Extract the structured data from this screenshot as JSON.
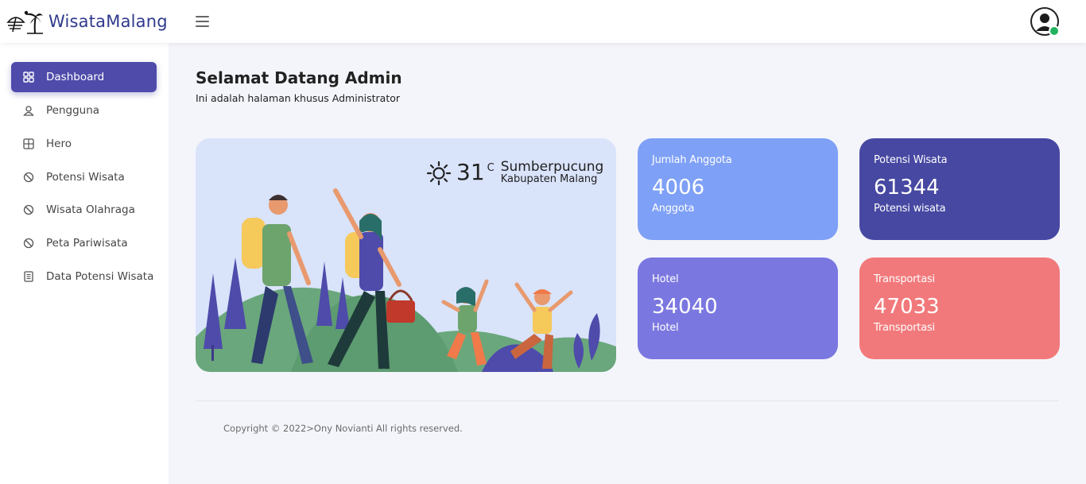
{
  "brand": {
    "name": "WisataMalang"
  },
  "sidebar": {
    "items": [
      {
        "label": "Dashboard",
        "icon": "grid-icon",
        "active": true
      },
      {
        "label": "Pengguna",
        "icon": "user-icon",
        "active": false
      },
      {
        "label": "Hero",
        "icon": "table-icon",
        "active": false
      },
      {
        "label": "Potensi Wisata",
        "icon": "ban-icon",
        "active": false
      },
      {
        "label": "Wisata Olahraga",
        "icon": "ban-icon",
        "active": false
      },
      {
        "label": "Peta Pariwisata",
        "icon": "ban-icon",
        "active": false
      },
      {
        "label": "Data Potensi Wisata",
        "icon": "document-icon",
        "active": false
      }
    ]
  },
  "main": {
    "title": "Selamat Datang Admin",
    "subtitle": "Ini adalah halaman khusus Administrator",
    "weather": {
      "icon": "sun-icon",
      "temp": "31",
      "unit": "C",
      "city": "Sumberpucung",
      "region": "Kabupaten Malang"
    },
    "stats": [
      {
        "label": "Jumlah Anggota",
        "value": "4006",
        "unit": "Anggota",
        "color": "#7ea0f6"
      },
      {
        "label": "Potensi Wisata",
        "value": "61344",
        "unit": "Potensi wisata",
        "color": "#4748a2"
      },
      {
        "label": "Hotel",
        "value": "34040",
        "unit": "Hotel",
        "color": "#7b77e0"
      },
      {
        "label": "Transportasi",
        "value": "47033",
        "unit": "Transportasi",
        "color": "#f2797b"
      }
    ]
  },
  "footer": {
    "copyright": "Copyright © 2022>Ony Novianti All rights reserved."
  },
  "colors": {
    "accent": "#4e4baa",
    "brand_text": "#2f3a8c",
    "hero_bg": "#d9e3fa"
  }
}
